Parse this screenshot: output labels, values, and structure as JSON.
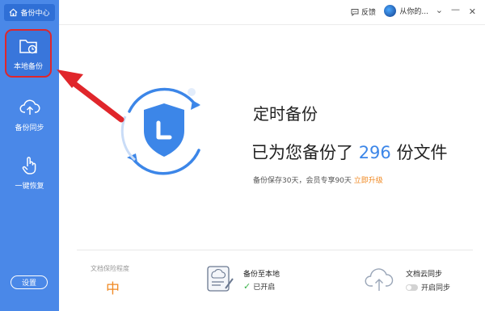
{
  "sidebar": {
    "home_label": "备份中心",
    "items": [
      {
        "label": "本地备份",
        "icon": "folder-clock-icon",
        "active": true
      },
      {
        "label": "备份同步",
        "icon": "cloud-upload-icon"
      },
      {
        "label": "一键恢复",
        "icon": "hand-pointer-icon"
      }
    ],
    "settings_label": "设置"
  },
  "topbar": {
    "feedback_label": "反馈",
    "user_name": "从你的...",
    "minimize": "—",
    "close": "✕",
    "dropdown": "⌄"
  },
  "main": {
    "title": "定时备份",
    "subtitle_prefix": "已为您备份了",
    "file_count": "296",
    "subtitle_suffix": "份文件",
    "info_text": "备份保存30天，会员专享90天",
    "upgrade_link": "立即升级"
  },
  "stats": {
    "risk_label": "文档保险程度",
    "risk_value": "中",
    "local_label": "备份至本地",
    "local_status": "已开启",
    "cloud_label": "文档云同步",
    "cloud_status": "开启同步"
  },
  "colors": {
    "sidebar": "#4a88e8",
    "accent": "#3c86e8",
    "orange": "#f08a24",
    "highlight_red": "#e0262b"
  }
}
